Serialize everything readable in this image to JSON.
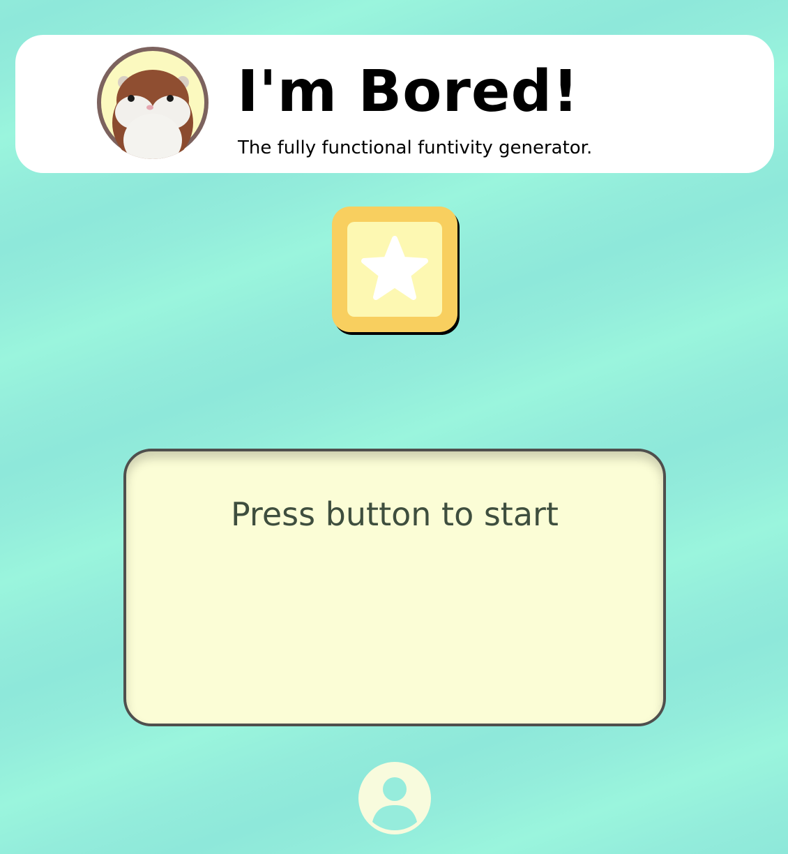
{
  "header": {
    "title": "I'm Bored!",
    "subtitle": "The fully functional funtivity generator.",
    "avatar_icon": "hamster-plush-avatar"
  },
  "action_button": {
    "icon": "star-icon"
  },
  "result": {
    "text": "Press button to start"
  },
  "footer": {
    "profile_icon": "user-icon"
  },
  "colors": {
    "background": "#93ecdb",
    "header_bg": "#ffffff",
    "button_outer": "#f8cf5f",
    "button_inner": "#fdf8b2",
    "card_bg": "#fbfdd6",
    "card_border": "#4f4f4d",
    "result_text": "#3e4e3e",
    "profile_icon": "#f8fbdd"
  }
}
